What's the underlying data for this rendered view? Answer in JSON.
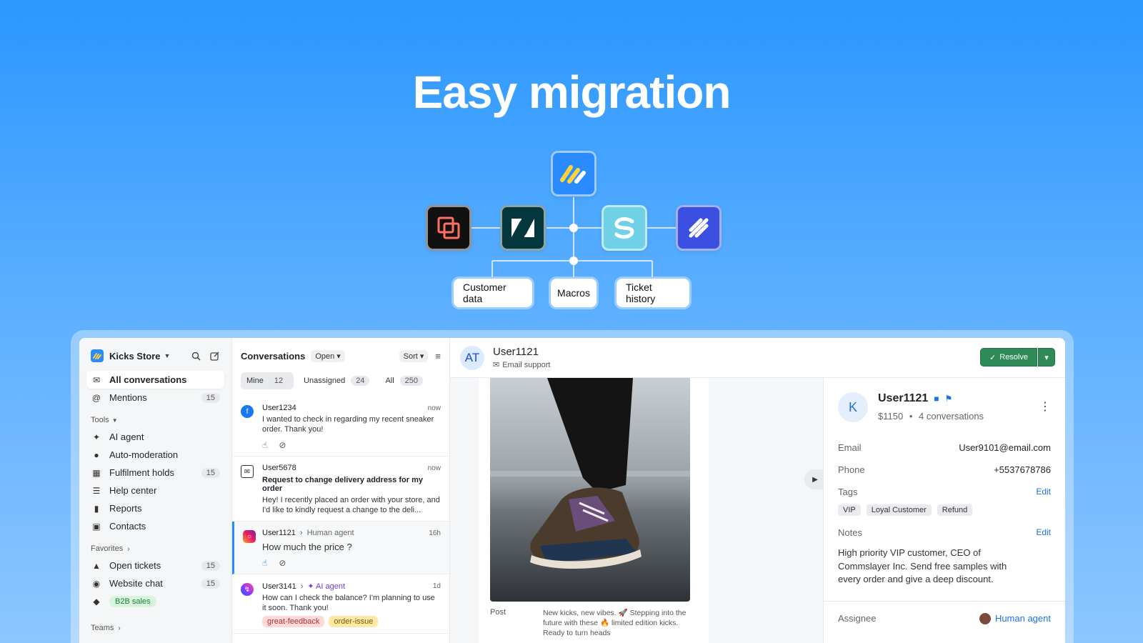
{
  "hero": {
    "title": "Easy migration"
  },
  "diagram": {
    "pills": [
      "Customer data",
      "Macros",
      "Ticket history"
    ],
    "colors": {
      "brand": "#2a8bff",
      "tile_dark": "#111111",
      "tile_zendesk": "#03363d",
      "tile_gorgias": "#6fd0e6",
      "tile_help": "#3b4fe0"
    }
  },
  "sidebar": {
    "store": "Kicks Store",
    "main_items": [
      {
        "label": "All conversations",
        "icon": "inbox-icon"
      },
      {
        "label": "Mentions",
        "icon": "at-icon",
        "count": "15"
      }
    ],
    "tools_label": "Tools",
    "tools": [
      {
        "label": "AI agent",
        "icon": "sparkle-icon"
      },
      {
        "label": "Auto-moderation",
        "icon": "robot-icon"
      },
      {
        "label": "Fulfilment holds",
        "icon": "store-icon",
        "count": "15"
      },
      {
        "label": "Help center",
        "icon": "book-icon"
      },
      {
        "label": "Reports",
        "icon": "chart-icon"
      },
      {
        "label": "Contacts",
        "icon": "contacts-icon"
      }
    ],
    "favorites_label": "Favorites",
    "favorites": [
      {
        "label": "Open tickets",
        "icon": "hat-icon",
        "count": "15"
      },
      {
        "label": "Website chat",
        "icon": "chat-icon",
        "count": "15"
      },
      {
        "label": "B2B sales",
        "icon": "tag-icon"
      }
    ],
    "teams_label": "Teams"
  },
  "convlist": {
    "title": "Conversations",
    "status": "Open",
    "sort": "Sort",
    "tabs": [
      {
        "label": "Mine",
        "count": "12"
      },
      {
        "label": "Unassigned",
        "count": "24"
      },
      {
        "label": "All",
        "count": "250"
      }
    ],
    "items": [
      {
        "user": "User1234",
        "time": "now",
        "body": "I wanted to check in regarding my recent sneaker order. Thank you!"
      },
      {
        "user": "User5678",
        "time": "now",
        "subject": "Request to change delivery address for my order",
        "body": "Hey! I recently placed an order with your store, and I'd like to kindly request a change to the deli..."
      },
      {
        "user": "User1121",
        "agent": "Human agent",
        "time": "16h",
        "body": "How much the price ?"
      },
      {
        "user": "User3141",
        "agent": "AI agent",
        "time": "1d",
        "body": "How can I check the balance? I'm planning to use it soon. Thank you!",
        "tags": [
          "great-feedback",
          "order-issue"
        ]
      }
    ]
  },
  "chat": {
    "user": "User1121",
    "initials": "AT",
    "channel": "Email support",
    "resolve": "Resolve",
    "post_label": "Post",
    "post_text": "New kicks, new vibes. 🚀 Stepping into the future with these 🔥 limited edition kicks. Ready to turn heads"
  },
  "profile": {
    "initial": "K",
    "name": "User1121",
    "spent": "$1150",
    "conversations": "4 conversations",
    "email_label": "Email",
    "email": "User9101@email.com",
    "phone_label": "Phone",
    "phone": "+5537678786",
    "tags_label": "Tags",
    "edit": "Edit",
    "tags": [
      "VIP",
      "Loyal Customer",
      "Refund"
    ],
    "notes_label": "Notes",
    "notes": "High priority VIP customer, CEO of Commslayer Inc. Send free samples with every order and give a deep discount.",
    "assignee_label": "Assignee",
    "assignee": "Human agent"
  }
}
